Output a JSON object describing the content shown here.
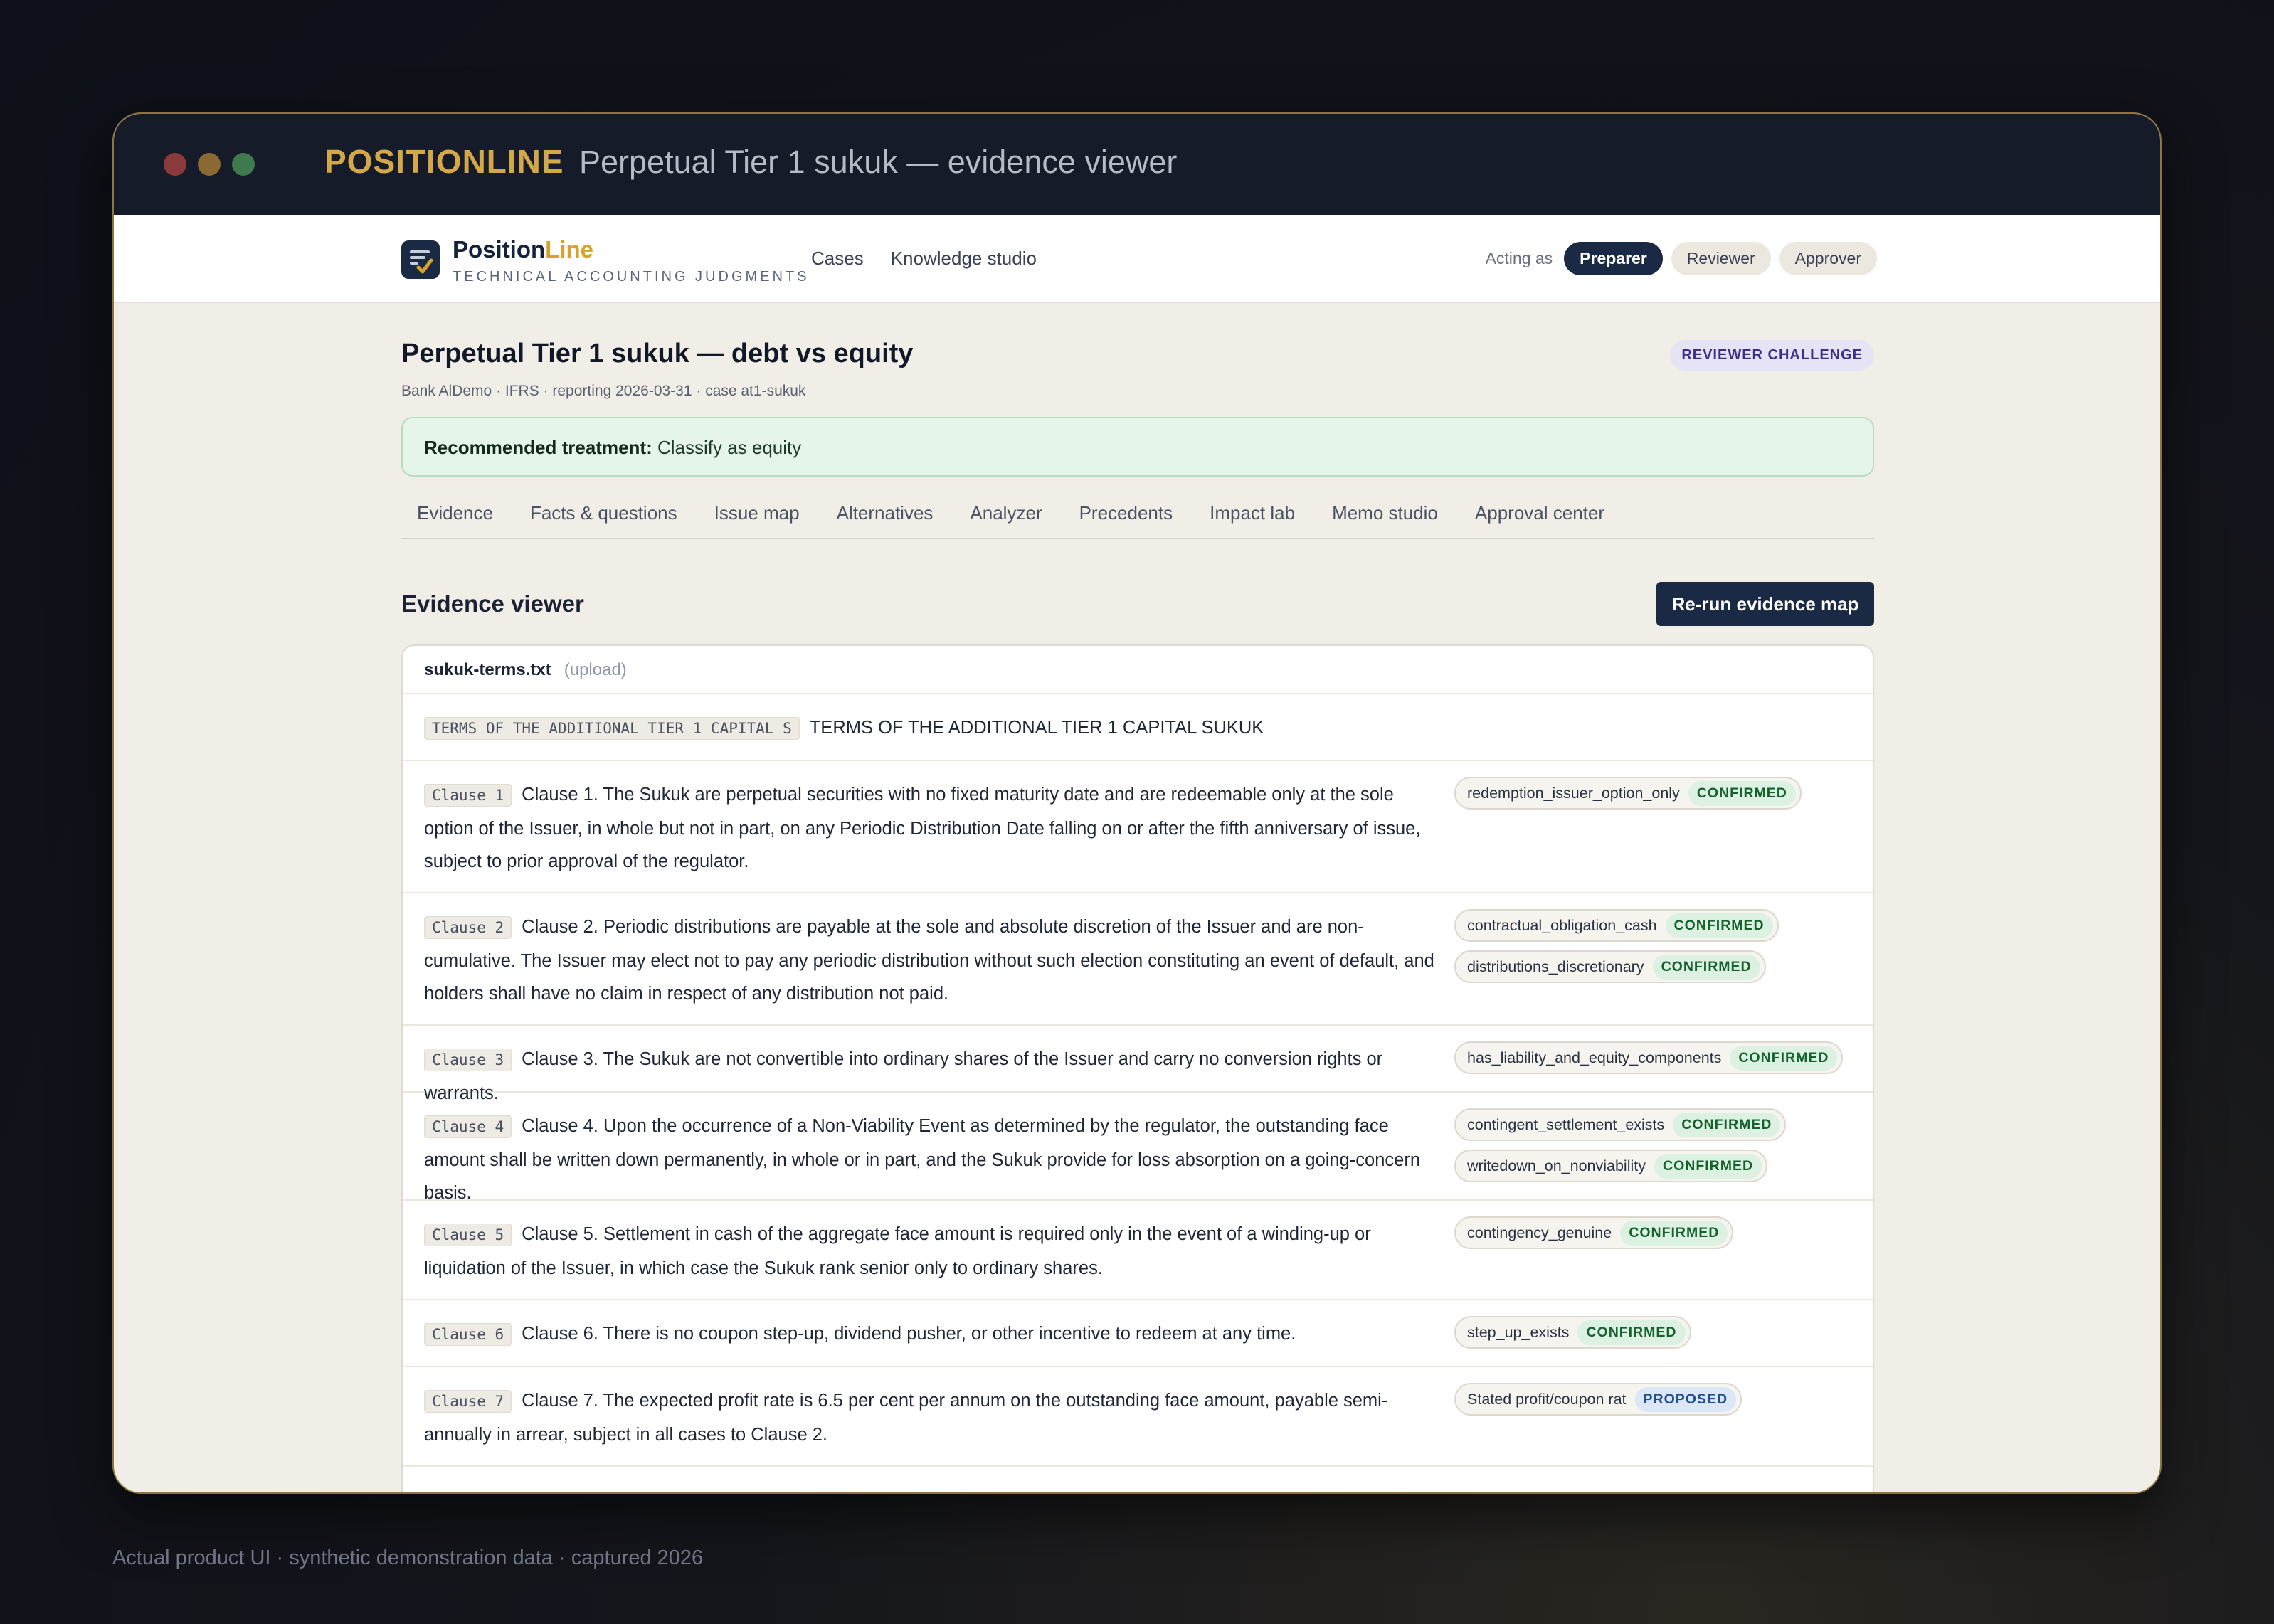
{
  "window": {
    "brand": "POSITIONLINE",
    "title": "Perpetual Tier 1 sukuk — evidence viewer"
  },
  "app": {
    "logo_name_a": "Position",
    "logo_name_b": "Line",
    "logo_sub": "TECHNICAL ACCOUNTING JUDGMENTS",
    "nav": [
      "Cases",
      "Knowledge studio"
    ],
    "acting_label": "Acting as",
    "roles": [
      {
        "label": "Preparer",
        "active": true
      },
      {
        "label": "Reviewer",
        "active": false
      },
      {
        "label": "Approver",
        "active": false
      }
    ]
  },
  "case": {
    "title": "Perpetual Tier 1 sukuk — debt vs equity",
    "meta": "Bank AlDemo · IFRS · reporting 2026-03-31 · case at1-sukuk",
    "status_badge": "REVIEWER CHALLENGE",
    "recommendation_label": "Recommended treatment:",
    "recommendation_value": "Classify as equity"
  },
  "tabs": [
    "Evidence",
    "Facts & questions",
    "Issue map",
    "Alternatives",
    "Analyzer",
    "Precedents",
    "Impact lab",
    "Memo studio",
    "Approval center"
  ],
  "evidence": {
    "section_title": "Evidence viewer",
    "rerun_label": "Re-run evidence map",
    "file_name": "sukuk-terms.txt",
    "file_source": "(upload)",
    "rows": [
      {
        "tag": "TERMS OF THE ADDITIONAL TIER 1 CAPITAL S",
        "text": "TERMS OF THE ADDITIONAL TIER 1 CAPITAL SUKUK",
        "facts": []
      },
      {
        "tag": "Clause 1",
        "text": "Clause 1. The Sukuk are perpetual securities with no fixed maturity date and are redeemable only at the sole option of the Issuer, in whole but not in part, on any Periodic Distribution Date falling on or after the fifth anniversary of issue, subject to prior approval of the regulator.",
        "facts": [
          {
            "name": "redemption_issuer_option_only",
            "status": "CONFIRMED"
          }
        ]
      },
      {
        "tag": "Clause 2",
        "text": "Clause 2. Periodic distributions are payable at the sole and absolute discretion of the Issuer and are non-cumulative. The Issuer may elect not to pay any periodic distribution without such election constituting an event of default, and holders shall have no claim in respect of any distribution not paid.",
        "facts": [
          {
            "name": "contractual_obligation_cash",
            "status": "CONFIRMED"
          },
          {
            "name": "distributions_discretionary",
            "status": "CONFIRMED"
          }
        ]
      },
      {
        "tag": "Clause 3",
        "text": "Clause 3. The Sukuk are not convertible into ordinary shares of the Issuer and carry no conversion rights or warrants.",
        "facts": [
          {
            "name": "has_liability_and_equity_components",
            "status": "CONFIRMED"
          }
        ]
      },
      {
        "tag": "Clause 4",
        "text": "Clause 4. Upon the occurrence of a Non-Viability Event as determined by the regulator, the outstanding face amount shall be written down permanently, in whole or in part, and the Sukuk provide for loss absorption on a going-concern basis.",
        "facts": [
          {
            "name": "contingent_settlement_exists",
            "status": "CONFIRMED"
          },
          {
            "name": "writedown_on_nonviability",
            "status": "CONFIRMED"
          }
        ]
      },
      {
        "tag": "Clause 5",
        "text": "Clause 5. Settlement in cash of the aggregate face amount is required only in the event of a winding-up or liquidation of the Issuer, in which case the Sukuk rank senior only to ordinary shares.",
        "facts": [
          {
            "name": "contingency_genuine",
            "status": "CONFIRMED"
          }
        ]
      },
      {
        "tag": "Clause 6",
        "text": "Clause 6. There is no coupon step-up, dividend pusher, or other incentive to redeem at any time.",
        "facts": [
          {
            "name": "step_up_exists",
            "status": "CONFIRMED"
          }
        ]
      },
      {
        "tag": "Clause 7",
        "text": "Clause 7. The expected profit rate is 6.5 per cent per annum on the outstanding face amount, payable semi-annually in arrear, subject in all cases to Clause 2.",
        "facts": [
          {
            "name": "Stated profit/coupon rat",
            "status": "PROPOSED"
          }
        ]
      }
    ]
  },
  "caption": "Actual product UI · synthetic demonstration data · captured 2026"
}
